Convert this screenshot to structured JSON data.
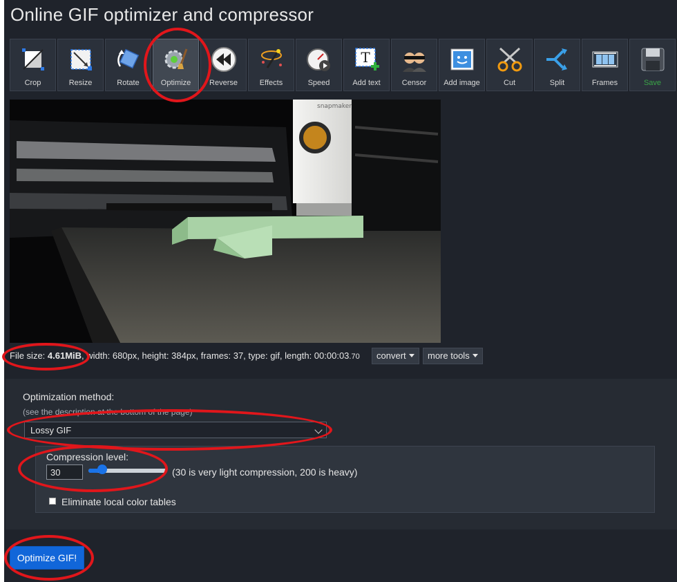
{
  "page": {
    "title": "Online GIF optimizer and compressor"
  },
  "toolbar": {
    "items": [
      {
        "label": "Crop",
        "icon": "crop-icon"
      },
      {
        "label": "Resize",
        "icon": "resize-icon"
      },
      {
        "label": "Rotate",
        "icon": "rotate-icon"
      },
      {
        "label": "Optimize",
        "icon": "optimize-icon",
        "active": true
      },
      {
        "label": "Reverse",
        "icon": "reverse-icon"
      },
      {
        "label": "Effects",
        "icon": "effects-icon"
      },
      {
        "label": "Speed",
        "icon": "speed-icon"
      },
      {
        "label": "Add text",
        "icon": "add-text-icon"
      },
      {
        "label": "Censor",
        "icon": "censor-icon"
      },
      {
        "label": "Add image",
        "icon": "add-image-icon"
      },
      {
        "label": "Cut",
        "icon": "cut-icon"
      },
      {
        "label": "Split",
        "icon": "split-icon"
      },
      {
        "label": "Frames",
        "icon": "frames-icon"
      },
      {
        "label": "Save",
        "icon": "save-icon"
      }
    ]
  },
  "preview": {
    "logo_text": "snapmaker"
  },
  "file_info": {
    "size_label": "File size: ",
    "size_value": "4.61MiB",
    "details": ", width: 680px, height: 384px, frames: 37, type: gif, length: 00:00:03",
    "length_fraction": ".70",
    "convert_label": "convert",
    "more_tools_label": "more tools"
  },
  "optimization": {
    "method_label": "Optimization method:",
    "method_note": "(see the description at the bottom of the page)",
    "selected_method": "Lossy GIF",
    "compression_label": "Compression level:",
    "compression_value": "30",
    "compression_hint": "(30 is very light compression, 200 is heavy)",
    "eliminate_label": "Eliminate local color tables",
    "submit_label": "Optimize GIF!"
  },
  "colors": {
    "background": "#1f232b",
    "annotation_red": "#e1161b",
    "primary_button": "#1166d9",
    "save_green": "#3aa547"
  }
}
